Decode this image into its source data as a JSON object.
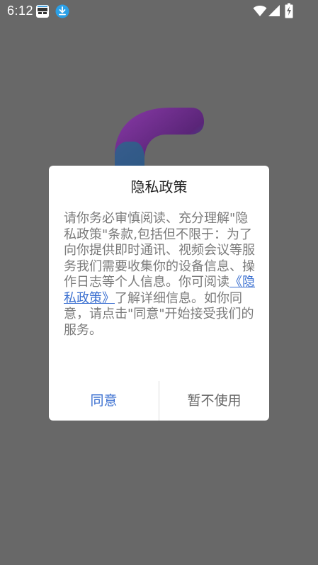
{
  "status_bar": {
    "time": "6:12",
    "icons": [
      "app-notification-icon",
      "download-icon",
      "wifi-icon",
      "cell-signal-icon",
      "battery-charging-icon"
    ]
  },
  "background": {
    "logo": "app-logo-icon",
    "colors": {
      "overlay": "#686868",
      "logo_purple": "#6a2a8c",
      "logo_teal": "#1d7f9a"
    }
  },
  "dialog": {
    "title": "隐私政策",
    "body_before_link": "请你务必审慎阅读、充分理解\"隐私政策\"条款,包括但不限于：为了向你提供即时通讯、视频会议等服务我们需要收集你的设备信息、操作日志等个人信息。你可阅读",
    "link_text": "《隐私政策》",
    "body_after_link": "了解详细信息。如你同意，请点击\"同意\"开始接受我们的服务。",
    "agree_label": "同意",
    "decline_label": "暂不使用",
    "colors": {
      "link": "#3a6fd0",
      "agree": "#3a6fd0",
      "decline": "#666666",
      "body_text": "#7a7a7a"
    }
  }
}
